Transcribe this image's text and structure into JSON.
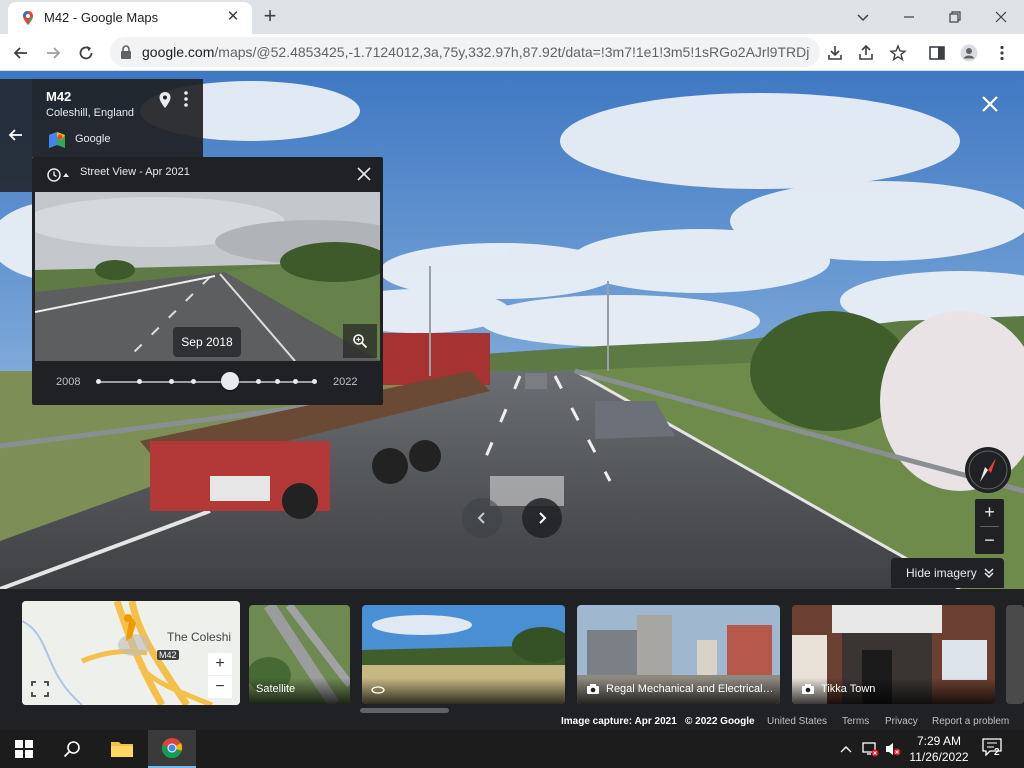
{
  "browser": {
    "tab_title": "M42 - Google Maps",
    "url_host": "google.com",
    "url_path": "/maps/@52.4853425,-1.7124012,3a,75y,332.97h,87.92t/data=!3m7!1e1!3m5!1sRGo2AJrl9TRDjV..."
  },
  "place": {
    "name": "M42",
    "locality": "Coleshill, England",
    "provider": "Google"
  },
  "timemachine": {
    "header": "Street View - Apr 2021",
    "tooltip": "Sep 2018",
    "year_start": "2008",
    "year_end": "2022",
    "selected_fraction": 0.68
  },
  "controls": {
    "zoom_in": "+",
    "zoom_out": "−",
    "hide_imagery": "Hide imagery"
  },
  "minimap": {
    "place_label": "The Coleshi",
    "road_label": "M42",
    "zoom_in": "+",
    "zoom_out": "−"
  },
  "filmstrip": [
    {
      "label": "Satellite"
    },
    {
      "label": ""
    },
    {
      "label": "Regal Mechanical and Electrical ..."
    },
    {
      "label": "Tikka Town"
    }
  ],
  "attribution": {
    "capture": "Image capture: Apr 2021",
    "copyright": "© 2022 Google",
    "country": "United States",
    "terms": "Terms",
    "privacy": "Privacy",
    "report": "Report a problem"
  },
  "taskbar": {
    "time": "7:29 AM",
    "date": "11/26/2022",
    "notifications": "2"
  },
  "colors": {
    "panel": "#202124",
    "chrome_tabbar": "#dee1e6",
    "taskbar": "#1c1c1c",
    "sky": "#4f86c8"
  }
}
